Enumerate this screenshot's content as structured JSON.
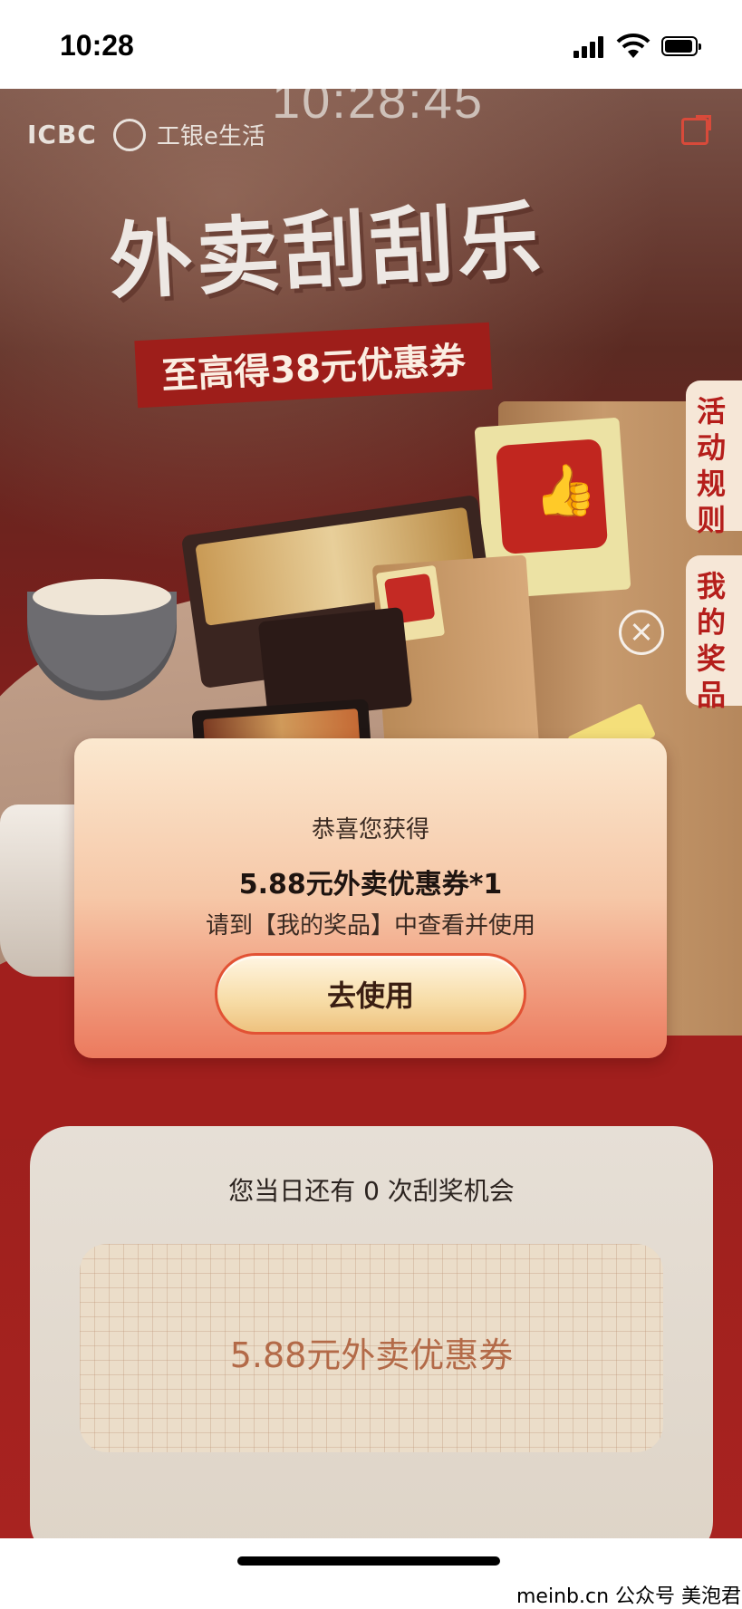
{
  "status_bar": {
    "time": "10:28"
  },
  "header": {
    "clock_ghost": "10:28:45",
    "logo_text": "ICBC",
    "logo_life": "工银e生活"
  },
  "banner": {
    "title": "外卖刮刮乐",
    "subtitle": "至高得38元优惠券"
  },
  "side_tabs": {
    "rules": [
      "活",
      "动",
      "规",
      "则"
    ],
    "prizes": [
      "我",
      "的",
      "奖",
      "品"
    ]
  },
  "popup": {
    "line1": "恭喜您获得",
    "prize": "5.88元外卖优惠券*1",
    "hint": "请到【我的奖品】中查看并使用",
    "button": "去使用"
  },
  "scratch": {
    "chances": "您当日还有 0 次刮奖机会",
    "prize": "5.88元外卖优惠券"
  },
  "watermark": "meinb.cn 公众号 美泡君",
  "colors": {
    "accent_red": "#a11f1d",
    "tab_text": "#b51e1b",
    "prize_text": "#b36a48"
  }
}
